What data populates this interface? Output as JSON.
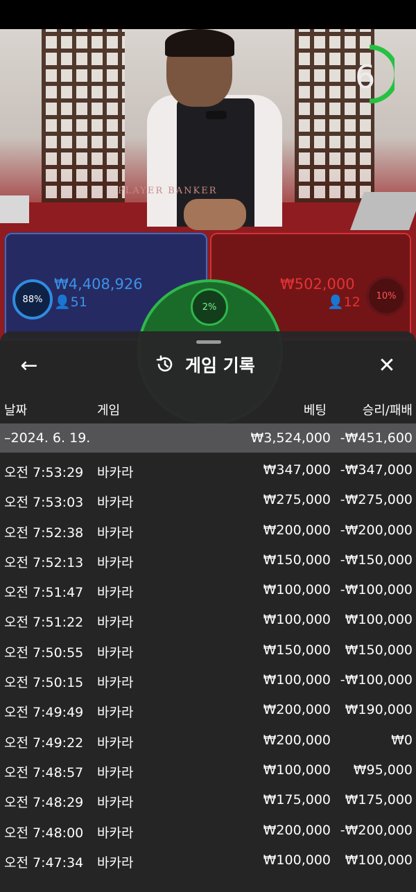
{
  "video": {
    "timer_value": "6",
    "table_label": "PLAYER    BANKER",
    "player_percent": "88%",
    "player_amount": "₩4,408,926",
    "player_count": "51",
    "banker_percent": "10%",
    "banker_amount": "₩502,000",
    "banker_count": "12",
    "tie_percent": "2%",
    "colors": {
      "player": "#2f8ce0",
      "banker": "#e23335",
      "tie": "#2fb84b"
    }
  },
  "sheet": {
    "back_icon": "←",
    "history_icon": "history-icon",
    "title": "게임 기록",
    "close_icon": "✕",
    "columns": {
      "date": "날짜",
      "game": "게임",
      "bet": "베팅",
      "result": "승리/패배"
    },
    "summary": {
      "date": "–2024. 6. 19.",
      "bet": "₩3,524,000",
      "result": "-₩451,600"
    },
    "rows": [
      {
        "time": "오전 7:53:29",
        "game": "바카라",
        "bet": "₩347,000",
        "result": "-₩347,000"
      },
      {
        "time": "오전 7:53:03",
        "game": "바카라",
        "bet": "₩275,000",
        "result": "-₩275,000"
      },
      {
        "time": "오전 7:52:38",
        "game": "바카라",
        "bet": "₩200,000",
        "result": "-₩200,000"
      },
      {
        "time": "오전 7:52:13",
        "game": "바카라",
        "bet": "₩150,000",
        "result": "-₩150,000"
      },
      {
        "time": "오전 7:51:47",
        "game": "바카라",
        "bet": "₩100,000",
        "result": "-₩100,000"
      },
      {
        "time": "오전 7:51:22",
        "game": "바카라",
        "bet": "₩100,000",
        "result": "₩100,000"
      },
      {
        "time": "오전 7:50:55",
        "game": "바카라",
        "bet": "₩150,000",
        "result": "₩150,000"
      },
      {
        "time": "오전 7:50:15",
        "game": "바카라",
        "bet": "₩100,000",
        "result": "-₩100,000"
      },
      {
        "time": "오전 7:49:49",
        "game": "바카라",
        "bet": "₩200,000",
        "result": "₩190,000"
      },
      {
        "time": "오전 7:49:22",
        "game": "바카라",
        "bet": "₩200,000",
        "result": "₩0"
      },
      {
        "time": "오전 7:48:57",
        "game": "바카라",
        "bet": "₩100,000",
        "result": "₩95,000"
      },
      {
        "time": "오전 7:48:29",
        "game": "바카라",
        "bet": "₩175,000",
        "result": "₩175,000"
      },
      {
        "time": "오전 7:48:00",
        "game": "바카라",
        "bet": "₩200,000",
        "result": "-₩200,000"
      },
      {
        "time": "오전 7:47:34",
        "game": "바카라",
        "bet": "₩100,000",
        "result": "₩100,000"
      }
    ]
  }
}
